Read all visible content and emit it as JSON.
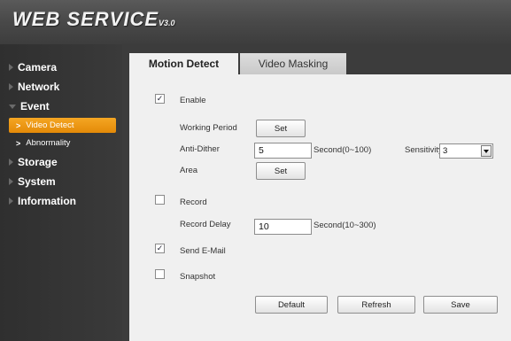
{
  "header": {
    "brand": "WEB SERVICE",
    "version": "V3.0"
  },
  "sidebar": {
    "items": [
      {
        "label": "Camera"
      },
      {
        "label": "Network"
      },
      {
        "label": "Event"
      },
      {
        "label": "Storage"
      },
      {
        "label": "System"
      },
      {
        "label": "Information"
      }
    ],
    "event_sub": [
      {
        "label": "Video Detect"
      },
      {
        "label": "Abnormality"
      }
    ]
  },
  "tabs": [
    {
      "label": "Motion Detect"
    },
    {
      "label": "Video Masking"
    }
  ],
  "form": {
    "enable_label": "Enable",
    "enable_checked": "✓",
    "working_period_label": "Working Period",
    "set_label": "Set",
    "anti_dither_label": "Anti-Dither",
    "anti_dither_value": "5",
    "anti_dither_unit": "Second(0~100)",
    "sensitivity_label": "Sensitivity",
    "sensitivity_value": "3",
    "area_label": "Area",
    "record_label": "Record",
    "record_checked": "",
    "record_delay_label": "Record Delay",
    "record_delay_value": "10",
    "record_delay_unit": "Second(10~300)",
    "send_email_label": "Send E-Mail",
    "send_email_checked": "✓",
    "snapshot_label": "Snapshot",
    "snapshot_checked": ""
  },
  "buttons": {
    "default": "Default",
    "refresh": "Refresh",
    "save": "Save"
  }
}
